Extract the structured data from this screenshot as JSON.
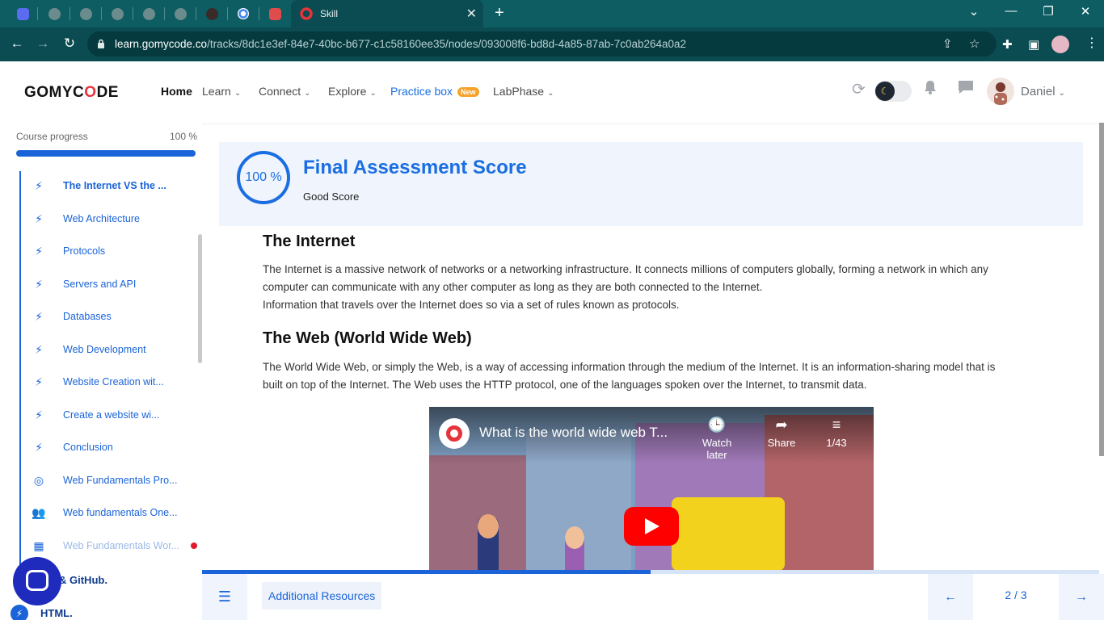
{
  "browser": {
    "active_tab_title": "Skill",
    "tab_close": "✕",
    "new_tab": "+",
    "url_domain": "learn.gomycode.co",
    "url_path": "/tracks/8dc1e3ef-84e7-40bc-b677-c1c58160ee35/nodes/093008f6-bd8d-4a85-87ab-7c0ab264a0a2",
    "window_controls": {
      "collapse": "⌄",
      "minimize": "—",
      "restore": "❐",
      "close": "✕"
    }
  },
  "header": {
    "logo_prefix": "GOMYC",
    "logo_o": "O",
    "logo_suffix": "DE",
    "nav": {
      "home": "Home",
      "learn": "Learn",
      "connect": "Connect",
      "explore": "Explore",
      "practice": "Practice box",
      "practice_badge": "New",
      "labphase": "LabPhase"
    },
    "chevron": "⌄",
    "user_name": "Daniel",
    "icons": {
      "refresh": "refresh-icon",
      "theme": "moon-icon",
      "bell": "bell-icon",
      "chat": "message-icon"
    }
  },
  "sidebar": {
    "progress_label": "Course progress",
    "progress_value": "100 %",
    "progress_fraction": 1.0,
    "lessons": [
      {
        "label": "The Internet VS the ...",
        "icon": "⚡",
        "state": "current"
      },
      {
        "label": "Web Architecture",
        "icon": "⚡",
        "state": "done"
      },
      {
        "label": "Protocols",
        "icon": "⚡",
        "state": "done"
      },
      {
        "label": "Servers and API",
        "icon": "⚡",
        "state": "done"
      },
      {
        "label": "Databases",
        "icon": "⚡",
        "state": "done"
      },
      {
        "label": "Web Development",
        "icon": "⚡",
        "state": "done"
      },
      {
        "label": "Website Creation wit...",
        "icon": "⚡",
        "state": "done"
      },
      {
        "label": "Create a website wi...",
        "icon": "⚡",
        "state": "done"
      },
      {
        "label": "Conclusion",
        "icon": "⚡",
        "state": "done"
      },
      {
        "label": "Web Fundamentals Pro...",
        "icon": "◎",
        "state": "done"
      },
      {
        "label": "Web fundamentals One...",
        "icon": "👥",
        "state": "done"
      },
      {
        "label": "Web Fundamentals Wor...",
        "icon": "▦",
        "state": "locked"
      }
    ],
    "chapters": [
      {
        "label": "& GitHub."
      },
      {
        "label": "HTML."
      }
    ]
  },
  "main": {
    "score": {
      "value": "100 %",
      "title": "Final Assessment Score",
      "subtitle": "Good Score"
    },
    "sections": [
      {
        "heading": "The Internet",
        "lines": [
          "The Internet is a massive network of networks or a networking infrastructure. It connects millions of computers globally, forming a network in which any",
          "computer can communicate with any other computer as long as they are both connected to the Internet.",
          "Information that travels over the Internet does so via a set of rules known as protocols."
        ]
      },
      {
        "heading": "The Web (World Wide Web)",
        "lines": [
          "The World Wide Web, or simply the Web, is a way of accessing information through the medium of the Internet. It is an information-sharing model that is",
          "built on top of the Internet. The Web uses the HTTP protocol, one of the languages spoken over the Internet, to transmit data."
        ]
      }
    ],
    "video": {
      "title": "What is the world wide web T...",
      "watch_later": "Watch later",
      "share": "Share",
      "playlist_pos": "1/43"
    }
  },
  "bottom": {
    "read_progress": 0.5,
    "additional_resources": "Additional Resources",
    "page_indicator": "2 / 3",
    "prev": "←",
    "next": "→",
    "menu_icon": "☰"
  }
}
